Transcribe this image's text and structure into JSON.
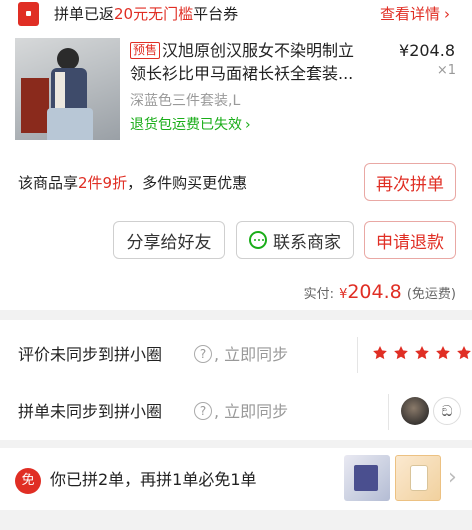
{
  "banner": {
    "text_prefix": "拼单已返",
    "text_highlight": "20元无门槛",
    "text_suffix": "平台券",
    "link": "查看详情"
  },
  "product": {
    "tag": "预售",
    "title_line1": "汉旭原创汉服女不染明制立",
    "title_line2": "领长衫比甲马面裙长袄全套装...",
    "price": "¥204.8",
    "quantity": "×1",
    "spec": "深蓝色三件套装,L",
    "return_notice": "退货包运费已失效"
  },
  "promo": {
    "prefix": "该商品享",
    "highlight": "2件9折",
    "suffix": "，多件购买更优惠",
    "rebuy_button": "再次拼单"
  },
  "actions": {
    "share": "分享给好友",
    "contact": "联系商家",
    "refund": "申请退款"
  },
  "payment": {
    "label": "实付:",
    "currency": "¥",
    "amount": "204.8",
    "note": "(免运费)"
  },
  "sync": {
    "review_label": "评价未同步到拼小圈",
    "review_action": "立即同步",
    "review_stars": 5,
    "order_label": "拼单未同步到拼小圈",
    "order_action": "立即同步"
  },
  "free_order": {
    "badge": "免",
    "text": "你已拼2单，再拼1单必免1单"
  },
  "colors": {
    "brand_red": "#e02e24",
    "green": "#1aad19"
  }
}
